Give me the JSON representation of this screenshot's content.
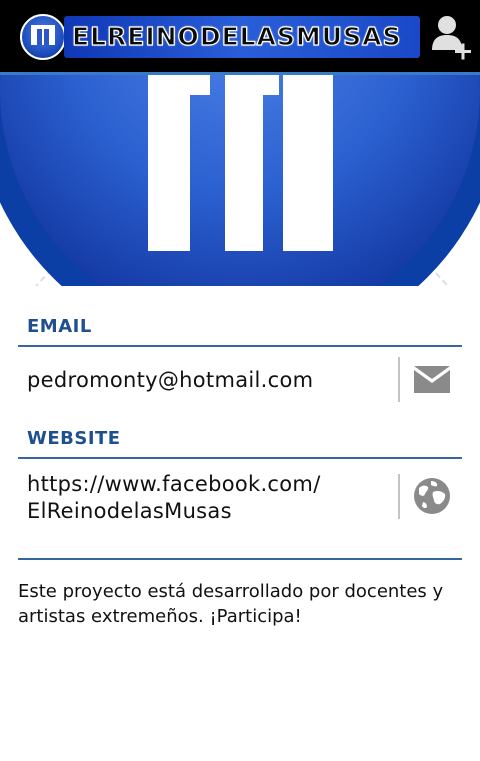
{
  "topbar": {
    "logo_text": "ELREINODELASMUSAS",
    "add_user_icon": "add-person-icon"
  },
  "contact": {
    "email_title": "EMAIL",
    "email_value": "pedromonty@hotmail.com",
    "email_icon": "envelope-icon",
    "website_title": "WEBSITE",
    "website_line1": "https://www.facebook.com/",
    "website_line2": "ElReinodelasMusas",
    "website_icon": "globe-icon"
  },
  "description": "Este proyecto está desarrollado por docentes y artistas extremeños. ¡Participa!",
  "colors": {
    "accent": "#1f4f8f",
    "rule": "#35679c",
    "bar": "#000000"
  }
}
